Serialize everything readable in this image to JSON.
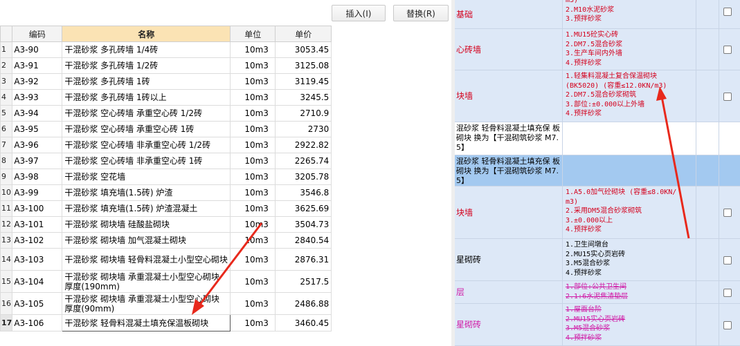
{
  "toolbar": {
    "insert_label": "插入(I)",
    "replace_label": "替换(R)"
  },
  "table": {
    "columns": [
      "编码",
      "名称",
      "单位",
      "单价"
    ],
    "rows": [
      {
        "rn": "1",
        "code": "A3-90",
        "name": "干混砂浆 多孔砖墙 1/4砖",
        "unit": "10m3",
        "price": "3053.45"
      },
      {
        "rn": "2",
        "code": "A3-91",
        "name": "干混砂浆 多孔砖墙 1/2砖",
        "unit": "10m3",
        "price": "3125.08"
      },
      {
        "rn": "3",
        "code": "A3-92",
        "name": "干混砂浆 多孔砖墙 1砖",
        "unit": "10m3",
        "price": "3119.45"
      },
      {
        "rn": "4",
        "code": "A3-93",
        "name": "干混砂浆 多孔砖墙 1砖以上",
        "unit": "10m3",
        "price": "3245.5"
      },
      {
        "rn": "5",
        "code": "A3-94",
        "name": "干混砂浆 空心砖墙 承重空心砖 1/2砖",
        "unit": "10m3",
        "price": "2710.9"
      },
      {
        "rn": "6",
        "code": "A3-95",
        "name": "干混砂浆 空心砖墙 承重空心砖 1砖",
        "unit": "10m3",
        "price": "2730"
      },
      {
        "rn": "7",
        "code": "A3-96",
        "name": "干混砂浆 空心砖墙 非承重空心砖 1/2砖",
        "unit": "10m3",
        "price": "2922.82"
      },
      {
        "rn": "8",
        "code": "A3-97",
        "name": "干混砂浆 空心砖墙 非承重空心砖 1砖",
        "unit": "10m3",
        "price": "2265.74"
      },
      {
        "rn": "9",
        "code": "A3-98",
        "name": "干混砂浆 空花墙",
        "unit": "10m3",
        "price": "3205.78"
      },
      {
        "rn": "10",
        "code": "A3-99",
        "name": "干混砂浆 填充墙(1.5砖) 炉渣",
        "unit": "10m3",
        "price": "3546.8"
      },
      {
        "rn": "11",
        "code": "A3-100",
        "name": "干混砂浆 填充墙(1.5砖) 炉渣混凝土",
        "unit": "10m3",
        "price": "3625.69"
      },
      {
        "rn": "12",
        "code": "A3-101",
        "name": "干混砂浆 砌块墙 硅酸盐砌块",
        "unit": "10m3",
        "price": "3504.73"
      },
      {
        "rn": "13",
        "code": "A3-102",
        "name": "干混砂浆 砌块墙 加气混凝土砌块",
        "unit": "10m3",
        "price": "2840.54"
      },
      {
        "rn": "14",
        "code": "A3-103",
        "name": "干混砂浆 砌块墙 轻骨料混凝土小型空心砌块",
        "unit": "10m3",
        "price": "2876.31"
      },
      {
        "rn": "15",
        "code": "A3-104",
        "name": "干混砂浆 砌块墙 承重混凝土小型空心砌块 厚度(190mm)",
        "unit": "10m3",
        "price": "2517.5"
      },
      {
        "rn": "16",
        "code": "A3-105",
        "name": "干混砂浆 砌块墙 承重混凝土小型空心砌块 厚度(90mm)",
        "unit": "10m3",
        "price": "2486.88"
      },
      {
        "rn": "17",
        "code": "A3-106",
        "name": "干混砂浆 轻骨料混凝土填充保温板砌块",
        "unit": "10m3",
        "price": "3460.45"
      }
    ]
  },
  "right": {
    "rows": [
      {
        "name": "基础",
        "name_color": "red",
        "desc": [
          "m3)",
          "2.M10水泥砂浆",
          "3.预拌砂浆"
        ],
        "desc_color": "red"
      },
      {
        "name": "心砖墙",
        "name_color": "red",
        "desc": [
          "1.MU15砼实心砖",
          "2.DM7.5混合砂浆",
          "3.生产车间内外墙",
          "4.预拌砂浆"
        ],
        "desc_color": "red"
      },
      {
        "name": "块墙",
        "name_color": "red",
        "desc": [
          "1.轻集料混凝土复合保温砌块",
          "(BK5020) (容重≤12.0KN/m3)",
          "2.DM7.5混合砂浆砌筑",
          "3.部位:±0.000以上外墙",
          "4.预拌砂浆"
        ],
        "desc_color": "red"
      },
      {
        "name": "混砂浆 轻骨料混凝土填充保 板砌块 换为【干混砌筑砂浆 M7.5】",
        "name_color": "black",
        "desc": [],
        "desc_color": "black"
      },
      {
        "name": "混砂浆 轻骨料混凝土填充保 板砌块 换为【干混砌筑砂浆 M7.5】",
        "name_color": "black",
        "desc": [],
        "desc_color": "black"
      },
      {
        "name": "块墙",
        "name_color": "red",
        "desc": [
          "1.A5.0加气砼砌块 (容重≤8.0KN/",
          "m3)",
          "2.采用DM5混合砂浆砌筑",
          "3.±0.000以上",
          "4.预拌砂浆"
        ],
        "desc_color": "red"
      },
      {
        "name": "星砌砖",
        "name_color": "black",
        "desc": [
          "1.卫生间墩台",
          "2.MU15实心页岩砖",
          "3.M5混合砂浆",
          "4.预拌砂浆"
        ],
        "desc_color": "black"
      },
      {
        "name": "层",
        "name_color": "magenta",
        "desc": [
          "1.部位:公共卫生间",
          "2.1:6水泥焦渣垫层"
        ],
        "desc_color": "magenta"
      },
      {
        "name": "星砌砖",
        "name_color": "magenta",
        "desc": [
          "1.屋面台阶",
          "2.MU15实心页岩砖",
          "3.M5混合砂浆",
          "4.预拌砂浆"
        ],
        "desc_color": "magenta"
      }
    ]
  },
  "colors": {
    "row_normal": "#dde8f7",
    "row_highlight": "#a3c9f0",
    "text_red": "#d4001c",
    "text_magenta": "#d01aa6",
    "arrow": "#e8291c",
    "header_selected": "#fbe3b4"
  }
}
